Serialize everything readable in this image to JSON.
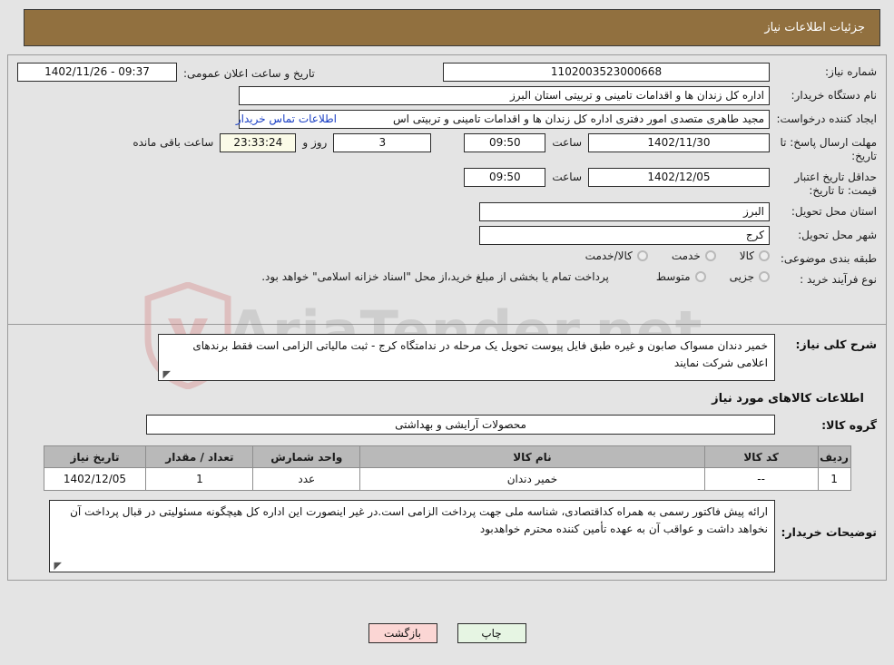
{
  "header": {
    "title": "جزئیات اطلاعات نیاز"
  },
  "form": {
    "need_number_label": "شماره نیاز:",
    "need_number_value": "1102003523000668",
    "announce_label": "تاریخ و ساعت اعلان عمومی:",
    "announce_value": "09:37 - 1402/11/26",
    "buyer_org_label": "نام دستگاه خریدار:",
    "buyer_org_value": "اداره کل زندان ها و اقدامات تامینی و تربیتی استان البرز",
    "creator_label": "ایجاد کننده درخواست:",
    "creator_value": "مجید طاهری متصدی امور دفتری اداره کل زندان ها و اقدامات تامینی و تربیتی اس",
    "contact_link": "اطلاعات تماس خریدار",
    "response_deadline_label": "مهلت ارسال پاسخ: تا تاریخ:",
    "response_deadline_date": "1402/11/30",
    "time_label": "ساعت",
    "response_deadline_time": "09:50",
    "remaining_days": "3",
    "days_and_label": "روز و",
    "remaining_time": "23:33:24",
    "remaining_suffix": "ساعت باقی مانده",
    "price_validity_label": "حداقل تاریخ اعتبار قیمت: تا تاریخ:",
    "price_validity_date": "1402/12/05",
    "price_validity_time": "09:50",
    "province_label": "استان محل تحویل:",
    "province_value": "البرز",
    "city_label": "شهر محل تحویل:",
    "city_value": "کرج",
    "category_label": "طبقه بندی موضوعی:",
    "category_options": [
      "کالا",
      "خدمت",
      "کالا/خدمت"
    ],
    "process_label": "نوع فرآیند خرید :",
    "process_options": [
      "جزیی",
      "متوسط"
    ],
    "process_note": "پرداخت تمام یا بخشی از مبلغ خرید،از محل \"اسناد خزانه اسلامی\" خواهد بود."
  },
  "description": {
    "label": "شرح کلی نیاز:",
    "value": "خمیر دندان مسواک صابون و غیره طبق فایل پیوست تحویل یک مرحله در ندامتگاه کرج - ثبت مالیاتی الزامی است فقط برندهای اعلامی شرکت نمایند"
  },
  "goods_section": {
    "title": "اطلاعات کالاهای مورد نیاز",
    "group_label": "گروه کالا:",
    "group_value": "محصولات آرایشی و بهداشتی",
    "columns": [
      "ردیف",
      "کد کالا",
      "نام کالا",
      "واحد شمارش",
      "تعداد / مقدار",
      "تاریخ نیاز"
    ],
    "rows": [
      {
        "radif": "1",
        "code": "--",
        "name": "خمیر دندان",
        "unit": "عدد",
        "qty": "1",
        "date": "1402/12/05"
      }
    ]
  },
  "buyer_notes": {
    "label": "توضیحات خریدار:",
    "value": "ارائه پیش فاکتور رسمی به همراه کداقتصادی، شناسه ملی جهت پرداخت الزامی است.در غیر اینصورت این اداره کل هیچگونه مسئولیتی در قبال پرداخت آن نخواهد داشت و عواقب آن به عهده تأمین کننده محترم خواهدبود"
  },
  "footer": {
    "print_label": "چاپ",
    "back_label": "بازگشت"
  },
  "watermark": {
    "text": "AriaTender.net"
  },
  "colors": {
    "header_bg": "#91703f",
    "page_bg": "#e4e4e4",
    "link": "#1a3fc4",
    "table_header": "#b9b9b9",
    "print_btn": "#e6f5e3",
    "back_btn": "#fbd6d4",
    "highlight_field": "#fbfbe8"
  }
}
